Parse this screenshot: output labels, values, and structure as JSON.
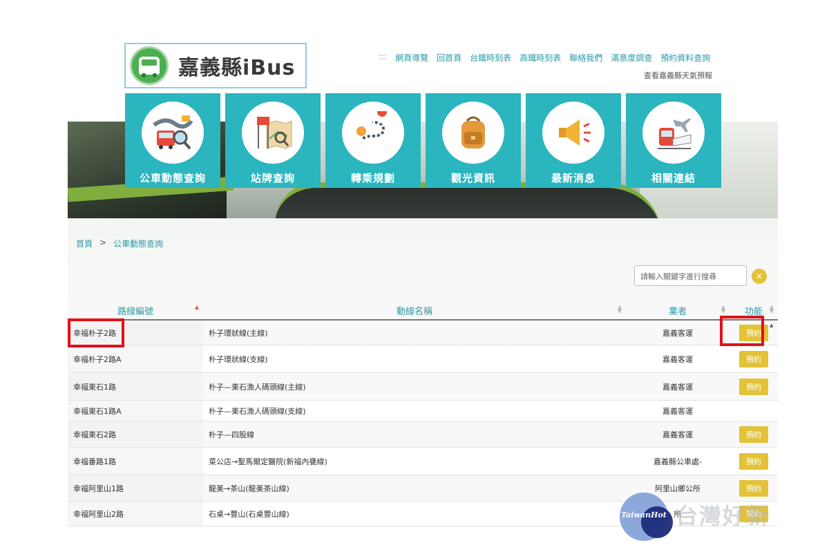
{
  "logo": {
    "text": "嘉義縣iBus"
  },
  "topnav": {
    "prefix": ":::",
    "items": [
      "網頁導覽",
      "回首頁",
      "台鐵時刻表",
      "高鐵時刻表",
      "聯絡我們",
      "滿意度調查",
      "預約資料查詢"
    ]
  },
  "weather_link": "查看嘉義縣天氣預報",
  "tiles": [
    {
      "label": "公車動態查詢",
      "icon": "bus-search-icon"
    },
    {
      "label": "站牌查詢",
      "icon": "bus-stop-map-icon"
    },
    {
      "label": "轉乘規劃",
      "icon": "route-plan-icon"
    },
    {
      "label": "觀光資訊",
      "icon": "backpack-icon"
    },
    {
      "label": "最新消息",
      "icon": "megaphone-icon"
    },
    {
      "label": "相關連結",
      "icon": "train-plane-icon"
    }
  ],
  "breadcrumb": {
    "home": "首頁",
    "sep": ">",
    "current": "公車動態查詢"
  },
  "search": {
    "placeholder": "請輸入關鍵字進行搜尋",
    "clear": "×"
  },
  "table": {
    "headers": [
      "路線編號",
      "動線名稱",
      "業者",
      "功能"
    ],
    "reserve_label": "預約",
    "rows": [
      {
        "id": "幸福朴子2路",
        "name": "朴子環狀線(主線)",
        "operator": "嘉義客運",
        "reservable": true
      },
      {
        "id": "幸福朴子2路A",
        "name": "朴子環狀線(支線)",
        "operator": "嘉義客運",
        "reservable": true
      },
      {
        "id": "幸福東石1路",
        "name": "朴子—東石漁人碼頭線(主線)",
        "operator": "嘉義客運",
        "reservable": true
      },
      {
        "id": "幸福東石1路A",
        "name": "朴子—東石漁人碼頭線(支線)",
        "operator": "嘉義客運",
        "reservable": false
      },
      {
        "id": "幸福東石2路",
        "name": "朴子—四股線",
        "operator": "嘉義客運",
        "reservable": true
      },
      {
        "id": "幸福番路1路",
        "name": "菜公店→聖馬爾定醫院(新福內甕線)",
        "operator": "嘉義縣公車處-",
        "reservable": true
      },
      {
        "id": "幸福阿里山1路",
        "name": "龍美→茶山(龍美茶山線)",
        "operator": "阿里山鄉公所",
        "reservable": true
      },
      {
        "id": "幸福阿里山2路",
        "name": "石桌→豐山(石桌豐山線)",
        "operator": "所",
        "reservable": true
      }
    ]
  },
  "watermark": {
    "latin": "TaiwanHot",
    "cjk": "台灣好新"
  },
  "colors": {
    "teal": "#2ab5bf",
    "link": "#2c9aa8",
    "button": "#e3c238",
    "highlight": "#e0111b"
  }
}
